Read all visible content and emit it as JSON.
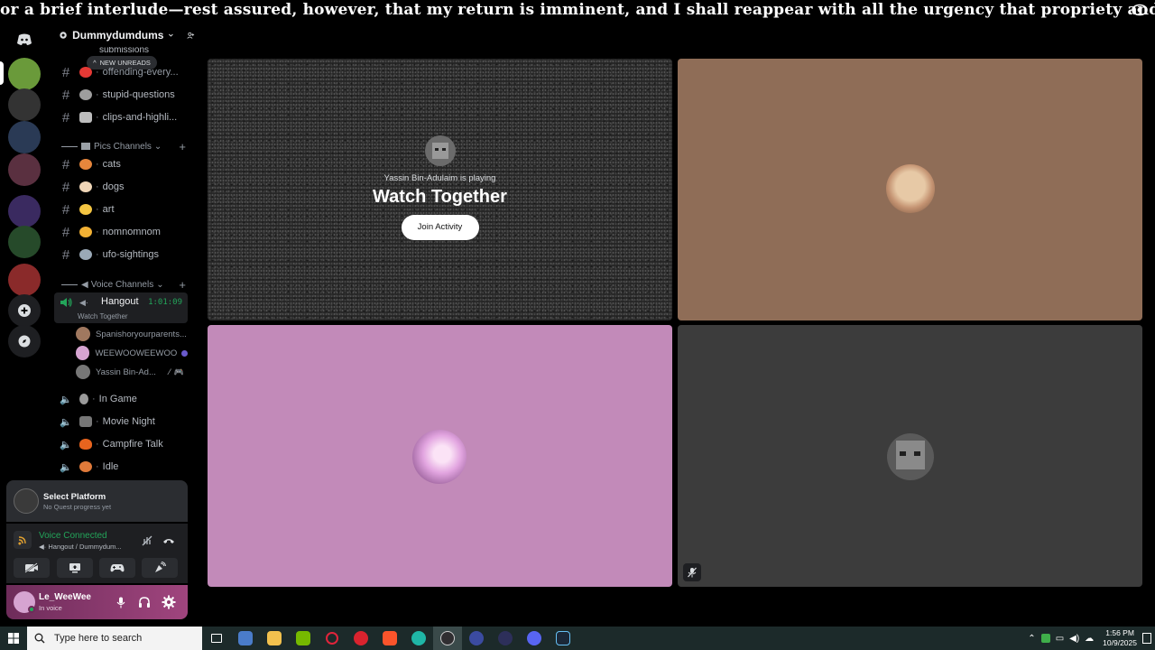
{
  "banner": {
    "marquee_text": "or a brief interlude—rest assured, however, that my return is imminent, and I shall reappear with all the urgency that propriety and circumstance permit.\""
  },
  "guild": {
    "name": "Dummydumdums",
    "new_unreads": "NEW UNREADS",
    "truncated_top_channel": "submissions"
  },
  "channels_top": [
    {
      "name": "offending-every...",
      "emoji_color": "#e53935"
    },
    {
      "name": "stupid-questions",
      "emoji_color": "#9e9e9e"
    },
    {
      "name": "clips-and-highli...",
      "emoji_color": "#bdbdbd"
    }
  ],
  "category_pics": "Pics Channels",
  "pics_channels": [
    {
      "name": "cats",
      "emoji_color": "#e6863c"
    },
    {
      "name": "dogs",
      "emoji_color": "#f0d6b8"
    },
    {
      "name": "art",
      "emoji_color": "#f4c542"
    },
    {
      "name": "nomnomnom",
      "emoji_color": "#f2b134"
    },
    {
      "name": "ufo-sightings",
      "emoji_color": "#9aa9b7"
    }
  ],
  "category_voice": "Voice Channels",
  "active_voice": {
    "name": "Hangout",
    "timer": "1:01:09",
    "activity": "Watch Together",
    "users": [
      {
        "name": "Spanishoryourparents...",
        "avatar_color": "#a0785f"
      },
      {
        "name": "WEEWOOWEEWOO",
        "avatar_color": "#d6a4d1"
      },
      {
        "name": "Yassin Bin-Ad...",
        "avatar_color": "#777777"
      }
    ]
  },
  "voice_channels": [
    {
      "name": "In Game"
    },
    {
      "name": "Movie Night"
    },
    {
      "name": "Campfire Talk"
    },
    {
      "name": "Idle"
    }
  ],
  "quest": {
    "title": "Select Platform",
    "subtitle": "No Quest progress yet"
  },
  "rtc": {
    "status": "Voice Connected",
    "location": "Hangout / Dummydum..."
  },
  "user": {
    "name": "Le_WeeWee",
    "status": "In voice"
  },
  "activity_tile": {
    "playing": "Yassin Bin-Adulaim is playing",
    "title": "Watch Together",
    "join_label": "Join Activity"
  },
  "taskbar": {
    "search_placeholder": "Type here to search",
    "time": "1:56 PM",
    "date": "10/9/2025"
  },
  "colors": {
    "voice_green": "#23a55a",
    "tile_brown": "#8f6d57",
    "tile_pink": "#c28ab9",
    "tile_gray": "#3c3c3c"
  }
}
